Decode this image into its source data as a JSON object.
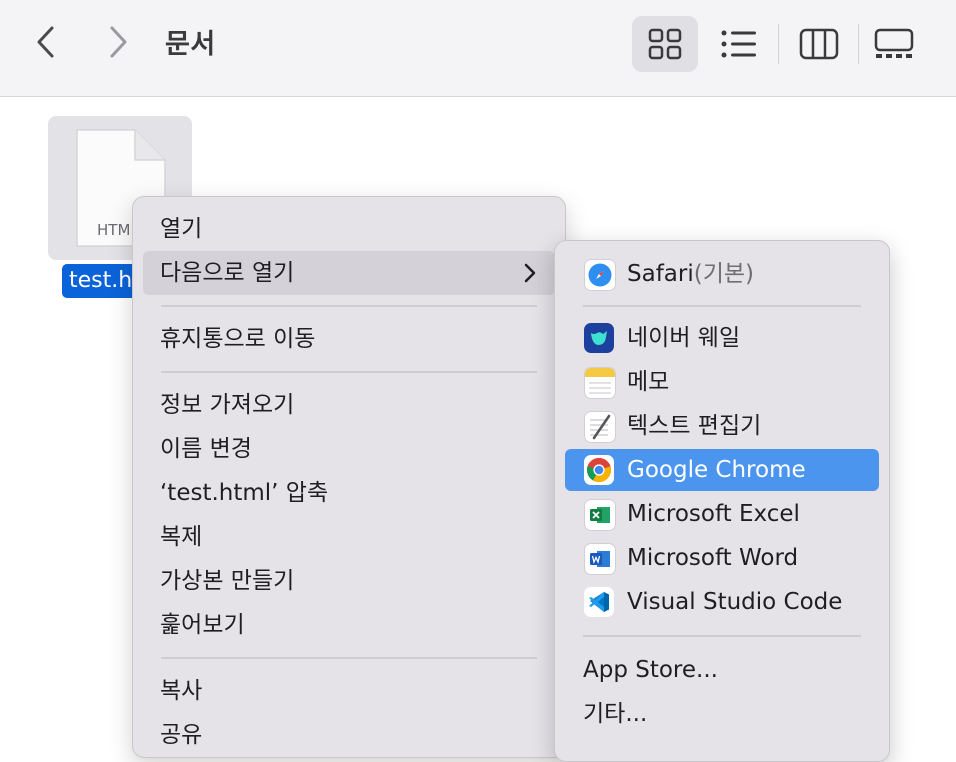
{
  "toolbar": {
    "folder_title": "문서",
    "back_icon": "chevron-left-icon",
    "forward_icon": "chevron-right-icon",
    "view_modes": [
      "icon-view-icon",
      "list-view-icon",
      "column-view-icon",
      "gallery-view-icon"
    ]
  },
  "file": {
    "ext_label": "HTM",
    "name_label": "test.h"
  },
  "context_menu": {
    "open": "열기",
    "open_with": "다음으로 열기",
    "move_to_trash": "휴지통으로 이동",
    "get_info": "정보 가져오기",
    "rename": "이름 변경",
    "compress": "‘test.html’ 압축",
    "duplicate": "복제",
    "make_alias": "가상본 만들기",
    "quick_look": "훑어보기",
    "copy": "복사",
    "share": "공유"
  },
  "submenu": {
    "safari": "Safari",
    "safari_default": "(기본)",
    "naver_whale": "네이버 웨일",
    "notes": "메모",
    "textedit": "텍스트 편집기",
    "chrome": "Google Chrome",
    "excel": "Microsoft Excel",
    "word": "Microsoft Word",
    "vscode": "Visual Studio Code",
    "app_store": "App Store...",
    "other": "기타..."
  },
  "colors": {
    "selection_blue": "#0a63d8",
    "submenu_highlight": "#4b95ee"
  }
}
